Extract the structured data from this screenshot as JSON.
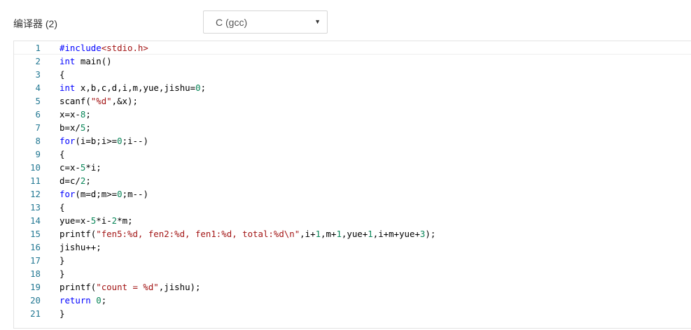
{
  "compiler_label": "编译器 (2)",
  "compiler_select": {
    "value": "C (gcc)",
    "caret": "▼"
  },
  "colors": {
    "keyword": "#0000ff",
    "number": "#098658",
    "string": "#a31515",
    "line_number": "#237893"
  },
  "code": [
    {
      "n": "1",
      "t": "#include<stdio.h>"
    },
    {
      "n": "2",
      "t": "int main()"
    },
    {
      "n": "3",
      "t": "{"
    },
    {
      "n": "4",
      "t": "int x,b,c,d,i,m,yue,jishu=0;"
    },
    {
      "n": "5",
      "t": "scanf(\"%d\",&x);"
    },
    {
      "n": "6",
      "t": "x=x-8;"
    },
    {
      "n": "7",
      "t": "b=x/5;"
    },
    {
      "n": "8",
      "t": "for(i=b;i>=0;i--)"
    },
    {
      "n": "9",
      "t": "{"
    },
    {
      "n": "10",
      "t": "c=x-5*i;"
    },
    {
      "n": "11",
      "t": "d=c/2;"
    },
    {
      "n": "12",
      "t": "for(m=d;m>=0;m--)"
    },
    {
      "n": "13",
      "t": "{"
    },
    {
      "n": "14",
      "t": "yue=x-5*i-2*m;"
    },
    {
      "n": "15",
      "t": "printf(\"fen5:%d, fen2:%d, fen1:%d, total:%d\\n\",i+1,m+1,yue+1,i+m+yue+3);"
    },
    {
      "n": "16",
      "t": "jishu++;"
    },
    {
      "n": "17",
      "t": "}"
    },
    {
      "n": "18",
      "t": "}"
    },
    {
      "n": "19",
      "t": "printf(\"count = %d\",jishu);"
    },
    {
      "n": "20",
      "t": "return 0;"
    },
    {
      "n": "21",
      "t": "}"
    }
  ]
}
